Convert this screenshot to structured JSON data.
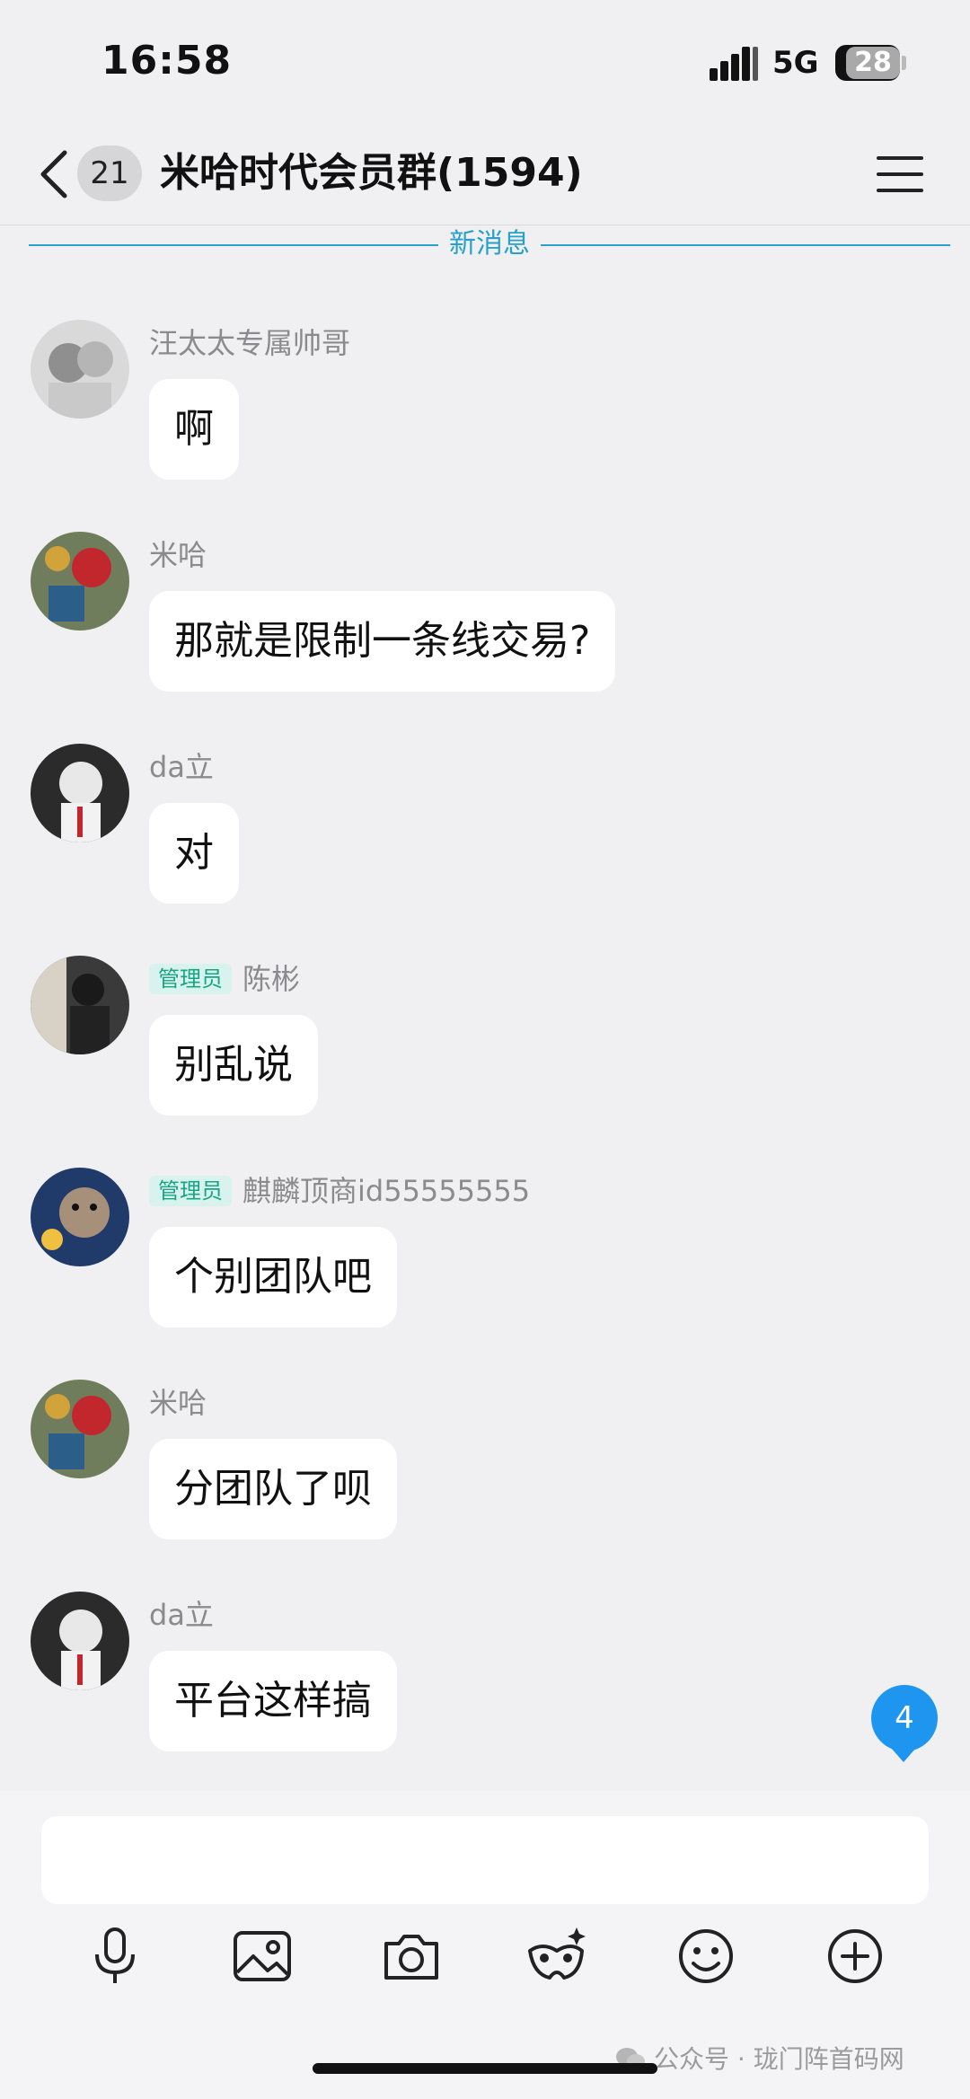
{
  "status_bar": {
    "time": "16:58",
    "network": "5G",
    "battery": "28"
  },
  "header": {
    "unread_count": "21",
    "title": "米哈时代会员群(1594)"
  },
  "divider": {
    "label": "新消息"
  },
  "messages": [
    {
      "sender": "汪太太专属帅哥",
      "badge": "",
      "text": "啊"
    },
    {
      "sender": "米哈",
      "badge": "",
      "text": "那就是限制一条线交易?"
    },
    {
      "sender": "da立",
      "badge": "",
      "text": "对"
    },
    {
      "sender": "陈彬",
      "badge": "管理员",
      "text": "别乱说"
    },
    {
      "sender": "麒麟顶商id55555555",
      "badge": "管理员",
      "text": "个别团队吧"
    },
    {
      "sender": "米哈",
      "badge": "",
      "text": "分团队了呗"
    },
    {
      "sender": "da立",
      "badge": "",
      "text": "平台这样搞"
    }
  ],
  "floating_unread": "4",
  "input": {
    "placeholder": ""
  },
  "toolbar_icons": [
    "microphone-icon",
    "image-icon",
    "camera-icon",
    "mask-icon",
    "emoji-icon",
    "plus-icon"
  ],
  "watermark": "公众号 · 珑门阵首码网",
  "colors": {
    "accent": "#27a1c8",
    "badge_bg": "#d8f3ee",
    "badge_text": "#19a486",
    "unread_blue": "#1e96f0"
  }
}
